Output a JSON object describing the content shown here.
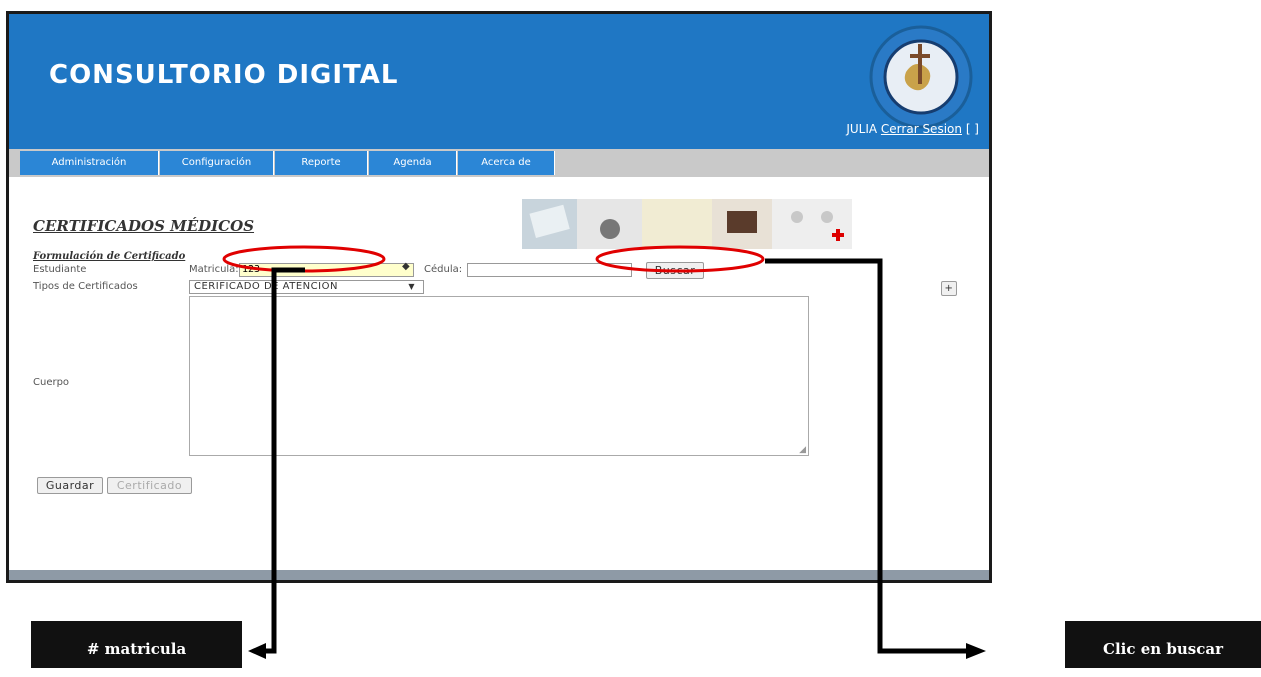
{
  "app": {
    "title": "CONSULTORIO DIGITAL"
  },
  "user": {
    "name": "JULIA",
    "logout_label": "Cerrar Sesion",
    "suffix": "[ ]"
  },
  "menu": [
    {
      "label": "Administración"
    },
    {
      "label": "Configuración"
    },
    {
      "label": "Reporte"
    },
    {
      "label": "Agenda"
    },
    {
      "label": "Acerca de"
    }
  ],
  "page": {
    "title": "CERTIFICADOS MÉDICOS",
    "subtitle": "Formulación de Certificado"
  },
  "form": {
    "estudiante_label": "Estudiante",
    "matricula_label": "Matricula:",
    "matricula_value": "123",
    "cedula_label": "Cédula:",
    "cedula_value": "",
    "buscar_label": "Buscar",
    "tipos_label": "Tipos de Certificados",
    "tipo_selected": "CERIFICADO DE ATENCION",
    "cuerpo_label": "Cuerpo",
    "add_label": "+",
    "guardar_label": "Guardar",
    "certificado_label": "Certificado"
  },
  "annotations": {
    "matricula": "# matricula",
    "buscar": "Clic en buscar"
  },
  "colors": {
    "header": "#1f77c4",
    "menu_item": "#2b86d6",
    "highlight_ellipse": "#e00000"
  }
}
